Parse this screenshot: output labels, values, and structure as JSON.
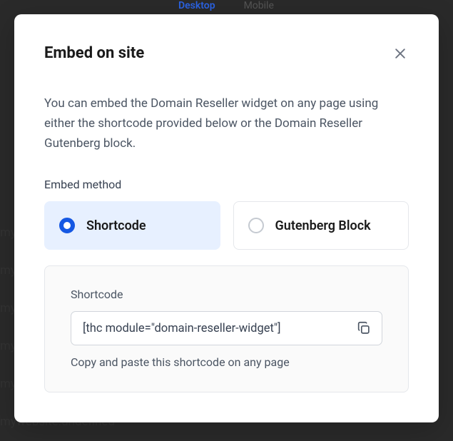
{
  "bg": {
    "tab1": "Desktop",
    "tab2": "Mobile",
    "line": "mywebsite.undefined"
  },
  "modal": {
    "title": "Embed on site",
    "description": "You can embed the Domain Reseller widget on any page using either the shortcode provided below or the Domain Reseller Gutenberg block.",
    "sectionLabel": "Embed method",
    "options": {
      "shortcode": "Shortcode",
      "gutenberg": "Gutenberg Block"
    },
    "shortcode": {
      "label": "Shortcode",
      "value": "[thc module=\"domain-reseller-widget\"]",
      "help": "Copy and paste this shortcode on any page"
    }
  }
}
